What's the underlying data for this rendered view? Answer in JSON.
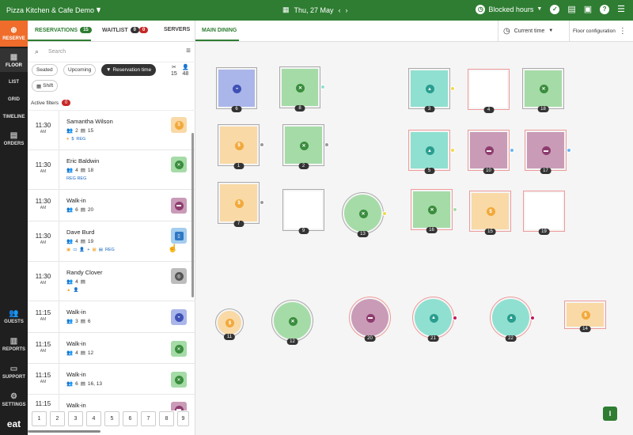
{
  "topbar": {
    "venue": "Pizza Kitchen & Cafe Demo",
    "date": "Thu, 27 May",
    "blocked_hours": "Blocked hours"
  },
  "nav": {
    "reserve": "RESERVE",
    "floor": "FLOOR",
    "list": "LIST",
    "grid": "GRID",
    "timeline": "TIMELINE",
    "orders": "ORDERS",
    "guests": "GUESTS",
    "reports": "REPORTS",
    "support": "SUPPORT",
    "settings": "SETTINGS",
    "logo": "eat"
  },
  "panel": {
    "tabs": {
      "reservations": "RESERVATIONS",
      "reservations_count": "15",
      "waitlist": "WAITLIST",
      "waitlist_a": "0",
      "waitlist_b": "0",
      "servers": "SERVERS"
    },
    "search_placeholder": "Search",
    "chips": {
      "seated": "Seated",
      "upcoming": "Upcoming",
      "reservation_time": "Reservation time",
      "shift": "Shift"
    },
    "counts": {
      "a": "15",
      "b": "48"
    },
    "active_filters": "Active filters",
    "active_filters_count": "0"
  },
  "reservations": [
    {
      "time": "11:30",
      "ampm": "AM",
      "name": "Samantha Wilson",
      "guests": "2",
      "table": "15",
      "tags": "REG",
      "color": "#f9d9a6",
      "icon": "#f2a93b"
    },
    {
      "time": "11:30",
      "ampm": "AM",
      "name": "Eric Baldwin",
      "guests": "4",
      "table": "18",
      "tags": "REG REG",
      "color": "#a5dba7",
      "icon": "#3a8d3e"
    },
    {
      "time": "11:30",
      "ampm": "AM",
      "name": "Walk-in",
      "guests": "6",
      "table": "20",
      "tags": "",
      "color": "#c99bb7",
      "icon": "#8e3c6e"
    },
    {
      "time": "11:30",
      "ampm": "AM",
      "name": "Dave Burd",
      "guests": "4",
      "table": "19",
      "tags": "REG",
      "color": "#a4cdee",
      "icon": "#2f78c4"
    },
    {
      "time": "11:30",
      "ampm": "AM",
      "name": "Randy Clover",
      "guests": "4",
      "table": "",
      "tags": "",
      "color": "#bdbdbd",
      "icon": "#555555"
    },
    {
      "time": "11:15",
      "ampm": "AM",
      "name": "Walk-in",
      "guests": "3",
      "table": "6",
      "tags": "",
      "color": "#aab6ea",
      "icon": "#3f51b5"
    },
    {
      "time": "11:15",
      "ampm": "AM",
      "name": "Walk-in",
      "guests": "4",
      "table": "12",
      "tags": "",
      "color": "#a5dba7",
      "icon": "#3a8d3e"
    },
    {
      "time": "11:15",
      "ampm": "AM",
      "name": "Walk-in",
      "guests": "6",
      "table": "16, 13",
      "tags": "",
      "color": "#a5dba7",
      "icon": "#3a8d3e"
    },
    {
      "time": "11:15",
      "ampm": "AM",
      "name": "Walk-in",
      "guests": "",
      "table": "",
      "tags": "",
      "color": "#c99bb7",
      "icon": "#8e3c6e"
    }
  ],
  "pager": [
    "1",
    "2",
    "3",
    "4",
    "5",
    "6",
    "7",
    "8",
    "9"
  ],
  "floor": {
    "area_tab": "MAIN DINING",
    "current_time": "Current time",
    "config": "Floor configuration"
  },
  "tables": {
    "t1": "1",
    "t2": "2",
    "t3": "3",
    "t4": "4",
    "t5": "5",
    "t6": "6",
    "t7": "7",
    "t8": "8",
    "t9": "9",
    "t10": "10",
    "t11": "11",
    "t12": "12",
    "t13": "13",
    "t14": "14",
    "t15": "15",
    "t16": "16",
    "t17": "17",
    "t18": "18",
    "t19": "19",
    "t20": "20",
    "t21": "21",
    "t22": "22"
  },
  "colors": {
    "green": "#a5dba7",
    "teal": "#8fe0d0",
    "orange": "#f9d9a6",
    "purple": "#c99bb7",
    "blue": "#aab6ea",
    "accent": "#2e7d32",
    "reserve": "#ef6c2b"
  }
}
